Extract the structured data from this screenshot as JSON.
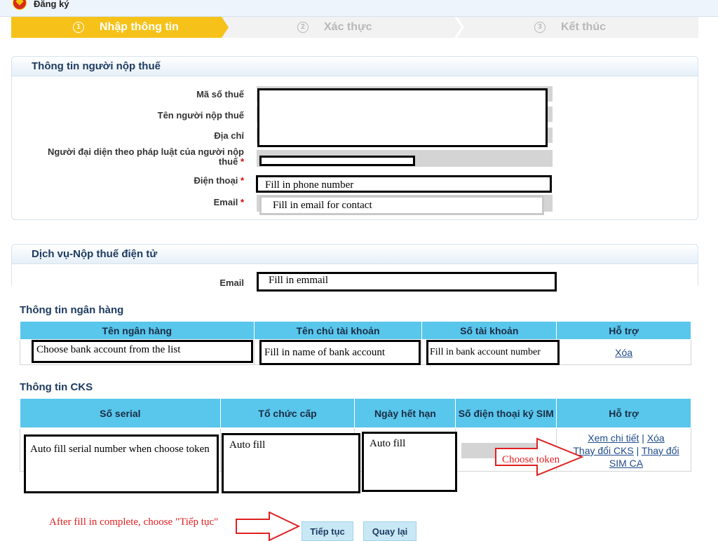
{
  "header": {
    "title": "Đăng ký"
  },
  "steps": [
    {
      "num": "1",
      "label": "Nhập thông tin",
      "active": true
    },
    {
      "num": "2",
      "label": "Xác thực",
      "active": false
    },
    {
      "num": "3",
      "label": "Kết thúc",
      "active": false
    }
  ],
  "taxpayer": {
    "section_title": "Thông tin người nộp thuế",
    "fields": {
      "tax_code": "Mã số thuế",
      "name": "Tên người nộp thuế",
      "address": "Địa chỉ",
      "rep_line1": "Người đại diện theo pháp luật của người nộp",
      "rep_line2": "thuế",
      "phone": "Điện thoại",
      "email": "Email"
    },
    "required_mark": "*",
    "phone_value": "Fill in phone number",
    "email_value": "Fill in email for contact"
  },
  "service": {
    "section_title": "Dịch vụ-Nộp thuế điện tử",
    "email_label": "Email",
    "email_value": "Fill in emmail"
  },
  "bank": {
    "title": "Thông tin ngân hàng",
    "columns": [
      "Tên ngân hàng",
      "Tên chủ tài khoản",
      "Số tài khoản",
      "Hỗ trợ"
    ],
    "row": {
      "bank_name": "Choose bank account from the list",
      "holder": "Fill in name of bank account",
      "number": "Fill in bank account number",
      "delete": "Xóa"
    }
  },
  "cks": {
    "title": "Thông tin CKS",
    "columns": [
      "Số serial",
      "Tổ chức cấp",
      "Ngày hết hạn",
      "Số điện thoại ký SIM",
      "Hỗ trợ"
    ],
    "row": {
      "serial": "Auto fill serial number when choose token",
      "issuer": "Auto fill",
      "expiry": "Auto fill",
      "view": "Xem chi tiết",
      "sep": "|",
      "delete": "Xóa",
      "change_cks": "Thay đổi CKS",
      "change_sim": "Thay đổi",
      "sim_ca": "SIM CA"
    }
  },
  "annotations": {
    "choose_token": "Choose token",
    "after_fill": "After fill in complete, choose \"Tiếp tục\""
  },
  "buttons": {
    "continue": "Tiếp tục",
    "back": "Quay lại"
  },
  "colors": {
    "step_active": "#f6c219",
    "table_header": "#59c6ec",
    "annotation_red": "#e02020",
    "section_title": "#1d3a5f"
  }
}
